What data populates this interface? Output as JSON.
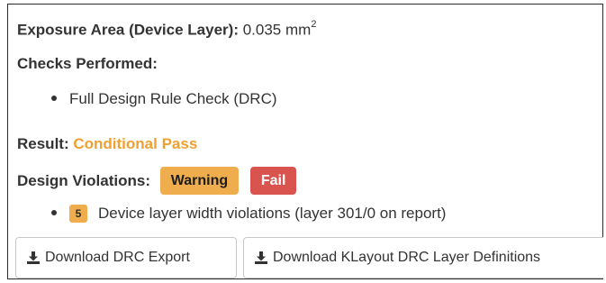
{
  "exposure": {
    "label": "Exposure Area (Device Layer):",
    "value": "0.035 mm",
    "superscript": "2"
  },
  "checks": {
    "heading": "Checks Performed:",
    "items": [
      "Full Design Rule Check (DRC)"
    ]
  },
  "result": {
    "label": "Result:",
    "value": "Conditional Pass",
    "value_color": "#f0a030"
  },
  "violations": {
    "label": "Design Violations:",
    "badges": [
      {
        "label": "Warning",
        "color": "#f0ad4e"
      },
      {
        "label": "Fail",
        "color": "#d9534f"
      }
    ],
    "items": [
      {
        "count": "5",
        "text": "Device layer width violations (layer 301/0 on report)"
      }
    ]
  },
  "buttons": {
    "drc_export": {
      "label": "Download DRC Export",
      "icon": "download-icon"
    },
    "klayout_defs": {
      "label": "Download KLayout DRC Layer Definitions",
      "icon": "download-icon"
    }
  }
}
